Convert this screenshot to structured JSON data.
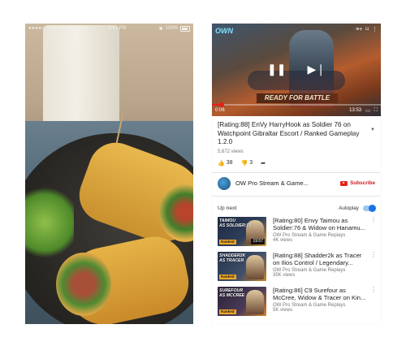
{
  "left_phone": {
    "status": {
      "carrier": "●●●●○ SKETCH",
      "time": "9:41 PM",
      "battery": "100%"
    },
    "photo": "food-wraps-on-plate"
  },
  "right_phone": {
    "player": {
      "logo": "OWN",
      "current_time": "0:06",
      "total_time": "13:53",
      "progress": 0.06,
      "banner_text": "READY FOR BATTLE",
      "icons": [
        "add-to-playlist-icon",
        "cast-icon",
        "more-icon",
        "play-pause-icon",
        "next-icon",
        "fullscreen-icon",
        "share-screen-icon"
      ]
    },
    "video": {
      "title": "[Rating:88] EnVy HarryHook as Soldier 76 on Watchpoint Gibraltar Escort / Ranked Gameplay 1.2.0",
      "views": "5,672 views",
      "likes": "38",
      "dislikes": "3"
    },
    "channel": {
      "name": "OW Pro Stream & Game...",
      "subscribe_label": "Subscribe"
    },
    "up_next": {
      "label": "Up next",
      "autoplay_label": "Autoplay",
      "autoplay_on": true
    },
    "items": [
      {
        "title": "[Rating:80] Envy Taimou as Soldier:76 & Widow on Hanamu...",
        "channel": "OW Pro Stream & Game Replays",
        "views": "4K views",
        "thumb_label": "TAIMOU\nAS SOLDIER:76",
        "duration": "19:57",
        "badge": "Ranked"
      },
      {
        "title": "[Rating:88] Shadder2k as Tracer on Ilios Control / Legendary...",
        "channel": "OW Pro Stream & Game Replays",
        "views": "35K views",
        "thumb_label": "SHADDER2K\nAS TRACER",
        "duration": "",
        "badge": "Ranked"
      },
      {
        "title": "[Rating:86] C9 Surefour as McCree, Widow & Tracer on Kin...",
        "channel": "OW Pro Stream & Game Replays",
        "views": "5K views",
        "thumb_label": "SUREFOUR\nAS MCCREE",
        "duration": "",
        "badge": "Ranked"
      }
    ]
  },
  "colors": {
    "accent_red": "#e62117",
    "toggle_blue": "#1a73e8"
  }
}
